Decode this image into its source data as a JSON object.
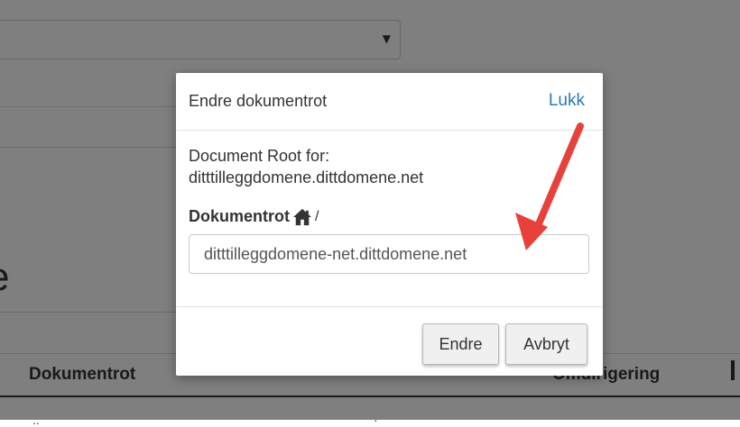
{
  "background": {
    "partial_heading": "e",
    "table_headers": {
      "document_root": "Dokumentrot",
      "redirect_partial": "Omdirigering"
    },
    "select_arrow": "▼",
    "row_marker_left": "..",
    "row_marker_mid": "·"
  },
  "modal": {
    "title": "Endre dokumentrot",
    "close_label": "Lukk",
    "root_for_label": "Document Root for:",
    "domain": "ditttilleggdomene.dittdomene.net",
    "field_label": "Dokumentrot",
    "path_prefix": "/",
    "input_value": "ditttilleggdomene-net.dittdomene.net",
    "change_button": "Endre",
    "cancel_button": "Avbryt"
  },
  "colors": {
    "link": "#2a7ab8",
    "annotation_arrow": "#e8403a"
  },
  "icons": {
    "home": "home-icon",
    "select": "chevron-down-icon",
    "annotation": "arrow-annotation-icon"
  }
}
